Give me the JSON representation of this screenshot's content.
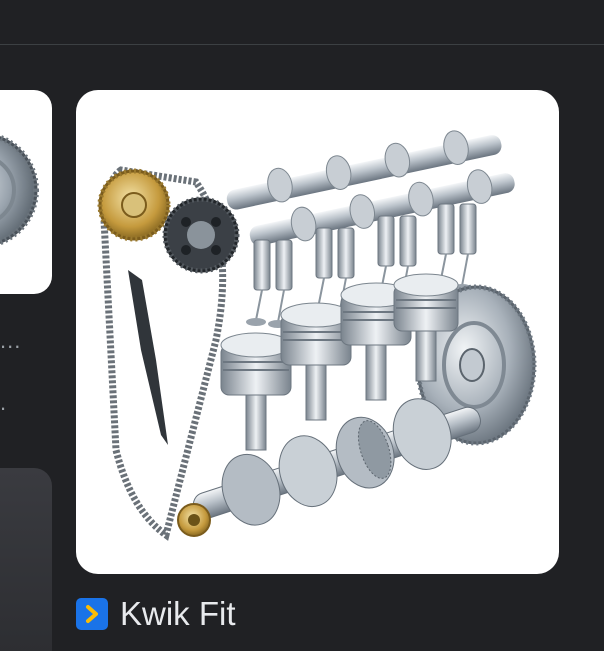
{
  "results": {
    "left_card": {
      "image": "flywheel-thumbnail",
      "caption_ellipsis": "...",
      "caption_dot": "."
    },
    "main_card": {
      "image": "engine-cutaway-illustration",
      "source": {
        "favicon": "chevron-right-icon",
        "favicon_color": "#1a73e8",
        "chevron_color": "#fbbc04",
        "name": "Kwik Fit"
      }
    }
  },
  "colors": {
    "background": "#202124",
    "divider": "#3c4043",
    "text": "#e8eaed",
    "muted_text": "#9aa0a6"
  }
}
